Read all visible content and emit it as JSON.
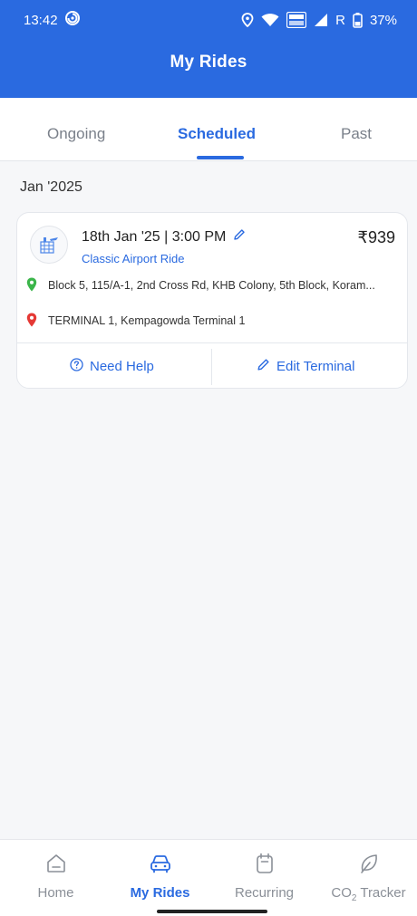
{
  "status_bar": {
    "time": "13:42",
    "signal_label": "R",
    "battery": "37%"
  },
  "header": {
    "title": "My Rides"
  },
  "tabs": [
    {
      "label": "Ongoing",
      "active": false
    },
    {
      "label": "Scheduled",
      "active": true
    },
    {
      "label": "Past",
      "active": false
    }
  ],
  "month_label": "Jan '2025",
  "ride": {
    "date_time": "18th Jan '25 | 3:00 PM",
    "ride_type": "Classic Airport Ride",
    "fare": "₹939",
    "pickup": "Block 5, 115/A-1, 2nd Cross Rd, KHB Colony, 5th Block, Koram...",
    "drop": "TERMINAL 1, Kempagowda Terminal 1",
    "actions": {
      "help": "Need Help",
      "edit": "Edit Terminal"
    }
  },
  "colors": {
    "primary": "#2a6ae0",
    "pickup_pin": "#3bb54a",
    "drop_pin": "#e53935"
  },
  "bottom_nav": [
    {
      "label": "Home",
      "icon": "home-icon",
      "active": false
    },
    {
      "label": "My Rides",
      "icon": "car-icon",
      "active": true
    },
    {
      "label": "Recurring",
      "icon": "calendar-icon",
      "active": false
    },
    {
      "label": "CO",
      "label_sub": "2",
      "label_suffix": " Tracker",
      "icon": "leaf-icon",
      "active": false
    }
  ]
}
